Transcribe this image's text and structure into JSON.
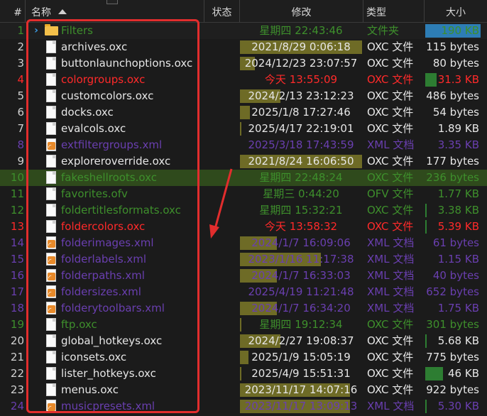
{
  "header": {
    "col_num": "#",
    "col_name": "名称",
    "col_status": "状态",
    "col_modified": "修改",
    "col_type": "类型",
    "col_size": "大小"
  },
  "colors": {
    "background": "#1b1b1b",
    "highlight_row": "#2f4a1c",
    "red_text": "#ff2a2a",
    "purple_text": "#6a3fb0",
    "green_text": "#3e8f2c",
    "date_bar": "#6e6b26",
    "size_bar_green": "#2d7d32",
    "annotation_red": "#e22d2d"
  },
  "rows": [
    {
      "num": "1",
      "name": "Filters",
      "icon": "folder-icon",
      "date": "星期四 22:43:46",
      "type": "文件夹",
      "size": "190 KB",
      "color": "dimgreen",
      "date_bar": 0,
      "size_bar": 0.95,
      "size_bar_color": "#2d7db5",
      "expander": true
    },
    {
      "num": "2",
      "name": "archives.oxc",
      "icon": "document-icon",
      "date": "2021/8/29 0:06:18",
      "type": "OXC 文件",
      "size": "115 bytes",
      "color": "normal",
      "date_bar": 1.0,
      "size_bar": 0
    },
    {
      "num": "3",
      "name": "buttonlaunchoptions.oxc",
      "icon": "document-icon",
      "date": "2024/12/23 23:07:57",
      "type": "OXC 文件",
      "size": "80 bytes",
      "color": "normal",
      "date_bar": 0.12,
      "size_bar": 0
    },
    {
      "num": "4",
      "name": "colorgroups.oxc",
      "icon": "document-icon",
      "date": "今天 13:55:09",
      "type": "OXC 文件",
      "size": "31.3 KB",
      "color": "red",
      "date_bar": 0,
      "size_bar": 0.2
    },
    {
      "num": "5",
      "name": "customcolors.oxc",
      "icon": "document-icon",
      "date": "2024/2/13 23:12:23",
      "type": "OXC 文件",
      "size": "486 bytes",
      "color": "normal",
      "date_bar": 0.33,
      "size_bar": 0
    },
    {
      "num": "6",
      "name": "docks.oxc",
      "icon": "document-icon",
      "date": "2025/1/8 17:27:46",
      "type": "OXC 文件",
      "size": "54 bytes",
      "color": "normal",
      "date_bar": 0.08,
      "size_bar": 0
    },
    {
      "num": "7",
      "name": "evalcols.oxc",
      "icon": "document-icon",
      "date": "2025/4/17 22:19:01",
      "type": "OXC 文件",
      "size": "1.89 KB",
      "color": "normal",
      "date_bar": 0.01,
      "size_bar": 0
    },
    {
      "num": "8",
      "name": "extfiltergroups.xml",
      "icon": "xml-feed-icon",
      "date": "2025/3/18 17:43:59",
      "type": "XML 文档",
      "size": "3.35 KB",
      "color": "purple",
      "date_bar": 0,
      "size_bar": 0
    },
    {
      "num": "9",
      "name": "exploreroverride.oxc",
      "icon": "document-icon",
      "date": "2021/8/24 16:06:50",
      "type": "OXC 文件",
      "size": "177 bytes",
      "color": "normal",
      "date_bar": 1.0,
      "size_bar": 0
    },
    {
      "num": "10",
      "name": "fakeshellroots.oxc",
      "icon": "document-icon",
      "date": "星期四 22:48:24",
      "type": "OXC 文件",
      "size": "236 bytes",
      "color": "highlight",
      "date_bar": 0,
      "size_bar": 0
    },
    {
      "num": "11",
      "name": "favorites.ofv",
      "icon": "document-icon",
      "date": "星期三 0:44:20",
      "type": "OFV 文件",
      "size": "1.77 KB",
      "color": "dimgreen",
      "date_bar": 0,
      "size_bar": 0
    },
    {
      "num": "12",
      "name": "foldertitlesformats.oxc",
      "icon": "document-icon",
      "date": "星期四 15:32:21",
      "type": "OXC 文件",
      "size": "3.38 KB",
      "color": "dimgreen",
      "date_bar": 0,
      "size_bar": 0.02
    },
    {
      "num": "13",
      "name": "foldercolors.oxc",
      "icon": "document-icon",
      "date": "今天 13:58:32",
      "type": "OXC 文件",
      "size": "5.39 KB",
      "color": "red",
      "date_bar": 0,
      "size_bar": 0.03
    },
    {
      "num": "14",
      "name": "folderimages.xml",
      "icon": "xml-feed-icon",
      "date": "2024/1/7 16:09:06",
      "type": "XML 文档",
      "size": "61 bytes",
      "color": "purple",
      "date_bar": 0.3,
      "size_bar": 0
    },
    {
      "num": "15",
      "name": "folderlabels.xml",
      "icon": "xml-feed-icon",
      "date": "2023/1/16 11:17:38",
      "type": "XML 文档",
      "size": "1.15 KB",
      "color": "purple",
      "date_bar": 0.66,
      "size_bar": 0
    },
    {
      "num": "16",
      "name": "folderpaths.xml",
      "icon": "xml-feed-icon",
      "date": "2024/1/7 16:33:03",
      "type": "XML 文档",
      "size": "40 bytes",
      "color": "purple",
      "date_bar": 0.3,
      "size_bar": 0
    },
    {
      "num": "17",
      "name": "foldersizes.xml",
      "icon": "xml-feed-icon",
      "date": "2025/4/19 11:21:48",
      "type": "XML 文档",
      "size": "652 bytes",
      "color": "purple",
      "date_bar": 0,
      "size_bar": 0
    },
    {
      "num": "18",
      "name": "folderytoolbars.xml",
      "icon": "xml-feed-icon",
      "date": "2024/1/7 16:34:20",
      "type": "XML 文档",
      "size": "1.75 KB",
      "color": "purple",
      "date_bar": 0.3,
      "size_bar": 0
    },
    {
      "num": "19",
      "name": "ftp.oxc",
      "icon": "document-icon",
      "date": "星期四 19:12:34",
      "type": "OXC 文件",
      "size": "301 bytes",
      "color": "dimgreen",
      "date_bar": 0.01,
      "size_bar": 0
    },
    {
      "num": "20",
      "name": "global_hotkeys.oxc",
      "icon": "document-icon",
      "date": "2024/2/27 19:08:37",
      "type": "OXC 文件",
      "size": "5.68 KB",
      "color": "normal",
      "date_bar": 0.33,
      "size_bar": 0.02
    },
    {
      "num": "21",
      "name": "iconsets.oxc",
      "icon": "document-icon",
      "date": "2025/1/9 15:05:19",
      "type": "OXC 文件",
      "size": "775 bytes",
      "color": "normal",
      "date_bar": 0.07,
      "size_bar": 0
    },
    {
      "num": "22",
      "name": "lister_hotkeys.oxc",
      "icon": "document-icon",
      "date": "2025/4/9 15:51:31",
      "type": "OXC 文件",
      "size": "46 KB",
      "color": "normal",
      "date_bar": 0.01,
      "size_bar": 0.3
    },
    {
      "num": "23",
      "name": "menus.oxc",
      "icon": "document-icon",
      "date": "2023/11/17 14:07:16",
      "type": "OXC 文件",
      "size": "922 bytes",
      "color": "normal",
      "date_bar": 0.9,
      "size_bar": 0
    },
    {
      "num": "24",
      "name": "musicpresets.xml",
      "icon": "xml-feed-icon",
      "date": "2023/11/17 13:09:13",
      "type": "XML 文档",
      "size": "5.30 KB",
      "color": "purple",
      "date_bar": 0.9,
      "size_bar": 0.02
    }
  ]
}
